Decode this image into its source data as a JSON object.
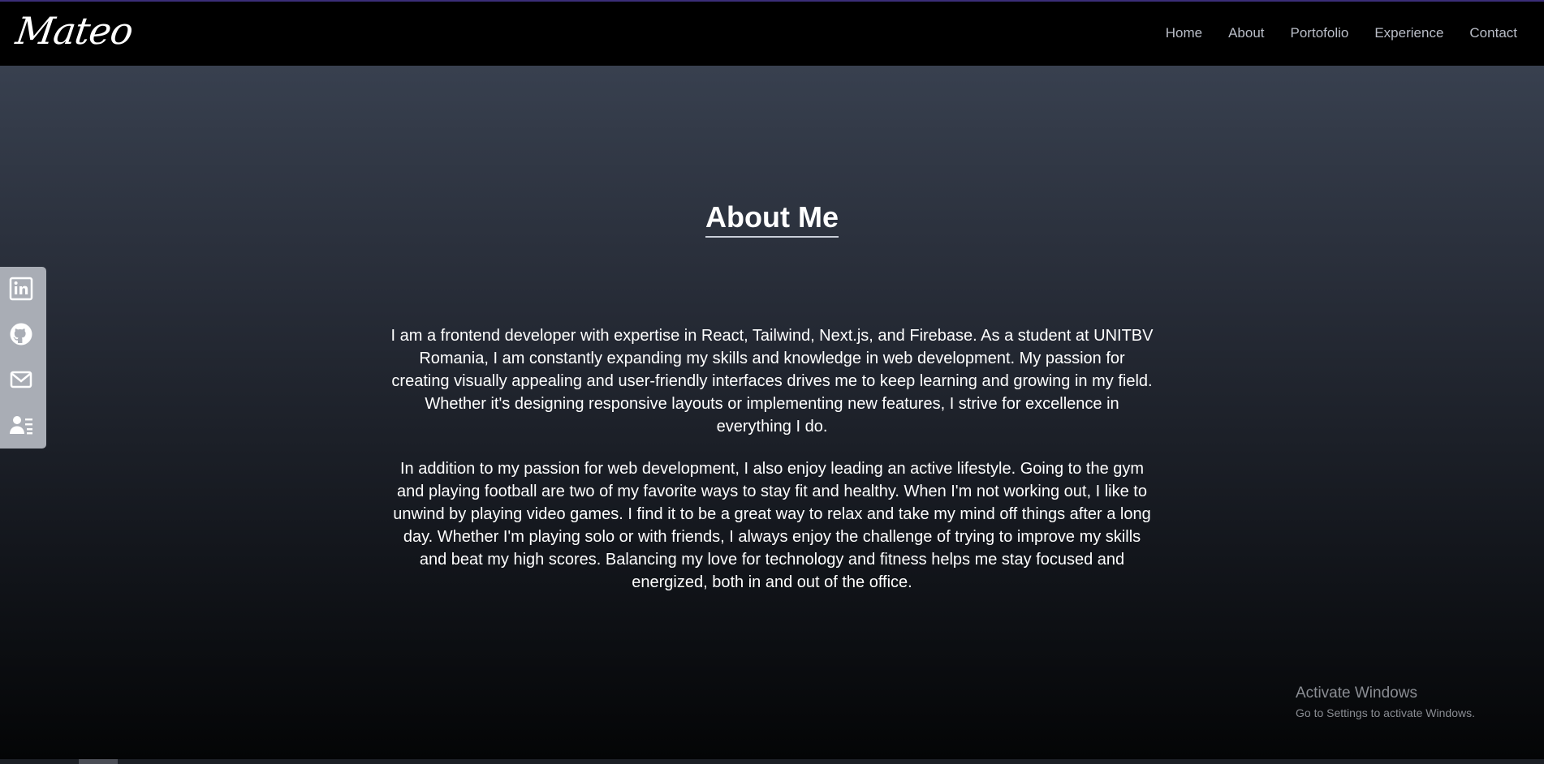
{
  "header": {
    "logo": "Mateo",
    "nav": [
      "Home",
      "About",
      "Portofolio",
      "Experience",
      "Contact"
    ]
  },
  "about": {
    "title": "About Me",
    "paragraphs": [
      "I am a frontend developer with expertise in React, Tailwind, Next.js, and Firebase. As a student at UNITBV Romania, I am constantly expanding my skills and knowledge in web development. My passion for creating visually appealing and user-friendly interfaces drives me to keep learning and growing in my field. Whether it's designing responsive layouts or implementing new features, I strive for excellence in everything I do.",
      "In addition to my passion for web development, I also enjoy leading an active lifestyle. Going to the gym and playing football are two of my favorite ways to stay fit and healthy. When I'm not working out, I like to unwind by playing video games. I find it to be a great way to relax and take my mind off things after a long day. Whether I'm playing solo or with friends, I always enjoy the challenge of trying to improve my skills and beat my high scores. Balancing my love for technology and fitness helps me stay focused and energized, both in and out of the office."
    ]
  },
  "social": {
    "icons": [
      "linkedin-icon",
      "github-icon",
      "mail-icon",
      "resume-icon"
    ]
  },
  "watermark": {
    "line1": "Activate Windows",
    "line2": "Go to Settings to activate Windows."
  },
  "colors": {
    "topbar_bg": "#000000",
    "nav_text": "#b9bdc7",
    "gradient_top": "#38404f",
    "gradient_bottom": "#040506",
    "social_bg": "#a9adb5"
  }
}
